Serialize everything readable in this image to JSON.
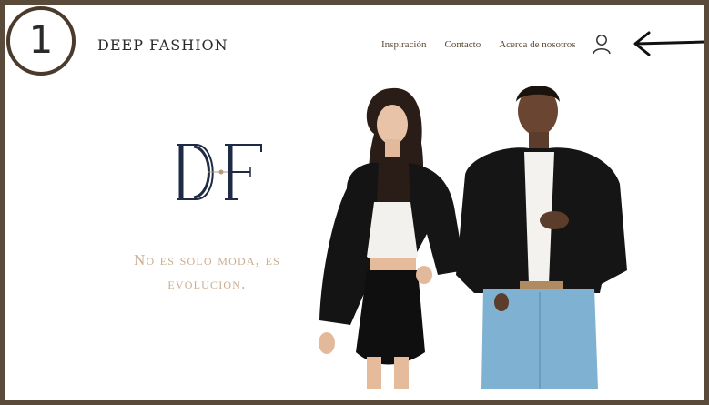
{
  "annotation": {
    "step_number": "1"
  },
  "header": {
    "brand": "DEEP FASHION",
    "nav": [
      {
        "label": "Inspiración"
      },
      {
        "label": "Contacto"
      },
      {
        "label": "Acerca de nosotros"
      }
    ],
    "user_icon": "user-icon"
  },
  "hero": {
    "logo_text": "DF",
    "tagline_line1": "No es solo moda, es",
    "tagline_line2": "evolucion.",
    "image": "couple-in-black-leather-jackets"
  },
  "colors": {
    "frame": "#5a4a3a",
    "logo": "#1f2a44",
    "tagline": "#c9ad90",
    "nav_text": "#5a4a38"
  }
}
